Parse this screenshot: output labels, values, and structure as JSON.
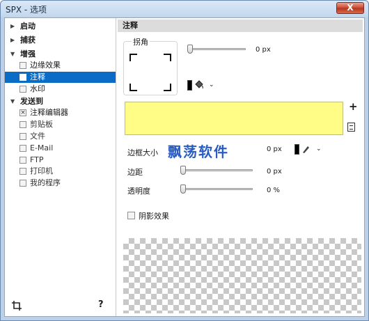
{
  "window": {
    "title": "SPX - 选项",
    "close_label": "X"
  },
  "sidebar": {
    "items": [
      {
        "type": "header",
        "label": "启动"
      },
      {
        "type": "header",
        "label": "捕获"
      },
      {
        "type": "header",
        "label": "增强"
      },
      {
        "type": "check",
        "label": "边缘效果",
        "checked": false
      },
      {
        "type": "check",
        "label": "注释",
        "checked": false,
        "selected": true
      },
      {
        "type": "check",
        "label": "水印",
        "checked": false
      },
      {
        "type": "header",
        "label": "发送到"
      },
      {
        "type": "check",
        "label": "注释编辑器",
        "checked": true
      },
      {
        "type": "check",
        "label": "剪贴板",
        "checked": false
      },
      {
        "type": "check",
        "label": "文件",
        "checked": false
      },
      {
        "type": "check",
        "label": "E-Mail",
        "checked": false
      },
      {
        "type": "check",
        "label": "FTP",
        "checked": false
      },
      {
        "type": "check",
        "label": "打印机",
        "checked": false
      },
      {
        "type": "check",
        "label": "我的程序",
        "checked": false
      }
    ],
    "help_label": "?"
  },
  "panel": {
    "header": "注释",
    "corner": {
      "label": "拐角",
      "value": "0 px",
      "slider_fraction": 0
    },
    "fill_color": "#fffd86",
    "border_size": {
      "label": "边框大小",
      "value": "0 px"
    },
    "margin": {
      "label": "边距",
      "value": "0 px",
      "slider_fraction": 0
    },
    "opacity": {
      "label": "透明度",
      "value": "0 %",
      "slider_fraction": 0
    },
    "shadow": {
      "label": "阴影效果",
      "checked": false
    },
    "watermark_text": "飘荡软件",
    "add_label": "+"
  },
  "colors": {
    "accent": "#0a6cc5",
    "header_bg": "#dcdcdc"
  }
}
